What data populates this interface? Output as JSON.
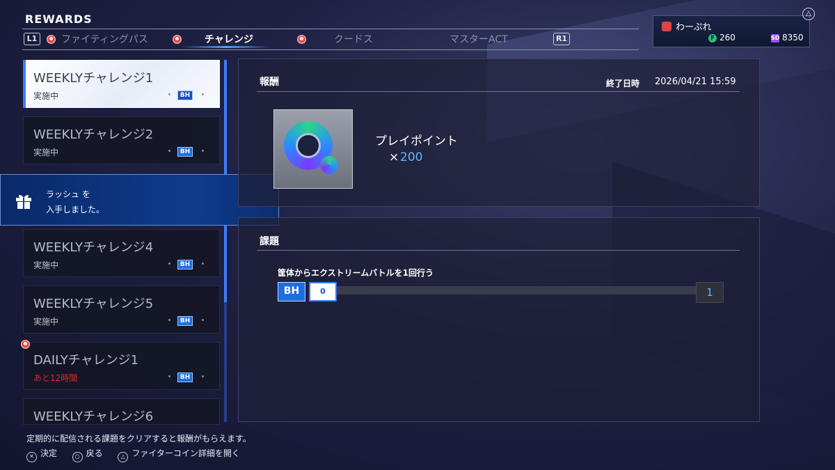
{
  "header": {
    "title": "REWARDS",
    "left_shoulder": "L1",
    "right_shoulder": "R1",
    "tabs": [
      {
        "label": "ファイティングパス",
        "has_alert": true,
        "active": false
      },
      {
        "label": "チャレンジ",
        "has_alert": true,
        "active": true
      },
      {
        "label": "クードス",
        "has_alert": true,
        "active": false
      },
      {
        "label": "マスターACT",
        "has_alert": false,
        "active": false
      }
    ]
  },
  "player": {
    "name": "わーぷれ",
    "fighter_coin": "260",
    "drive_coin": "8350",
    "triangle_label": "△"
  },
  "challenges": [
    {
      "title": "WEEKLYチャレンジ1",
      "status": "実施中",
      "badge": "BH",
      "selected": true,
      "alert": false
    },
    {
      "title": "WEEKLYチャレンジ2",
      "status": "実施中",
      "badge": "BH",
      "selected": false,
      "alert": false
    },
    {
      "title": "WEEKLYチャレンジ4",
      "status": "実施中",
      "badge": "BH",
      "selected": false,
      "alert": false
    },
    {
      "title": "WEEKLYチャレンジ5",
      "status": "実施中",
      "badge": "BH",
      "selected": false,
      "alert": false
    },
    {
      "title": "DAILYチャレンジ1",
      "status": "あと12時間",
      "badge": "BH",
      "selected": false,
      "alert": true
    },
    {
      "title": "WEEKLYチャレンジ6",
      "status": "",
      "badge": "",
      "selected": false,
      "alert": false
    }
  ],
  "toast": {
    "line1": "ラッシュ を",
    "line2": "入手しました。"
  },
  "reward_panel": {
    "heading": "報酬",
    "end_label": "終了日時",
    "end_date": "2026/04/21 15:59",
    "item_name": "プレイポイント",
    "item_quantity": "200",
    "quantity_prefix": "×"
  },
  "task_panel": {
    "heading": "課題",
    "task_text": "筐体からエクストリームバトルを1回行う",
    "progress_badge": "BH",
    "current": "0",
    "target": "1",
    "progress_fraction": 0
  },
  "footer": {
    "description": "定期的に配信される課題をクリアすると報酬がもらえます。",
    "actions": [
      {
        "glyph": "✕",
        "label": "決定"
      },
      {
        "glyph": "○",
        "label": "戻る"
      },
      {
        "glyph": "△",
        "label": "ファイターコイン詳細を開く"
      }
    ]
  },
  "colors": {
    "accent_blue": "#3c7dff",
    "alert_red": "#e54848",
    "danger_text": "#e0282b",
    "quantity_blue": "#5fb8ff"
  }
}
